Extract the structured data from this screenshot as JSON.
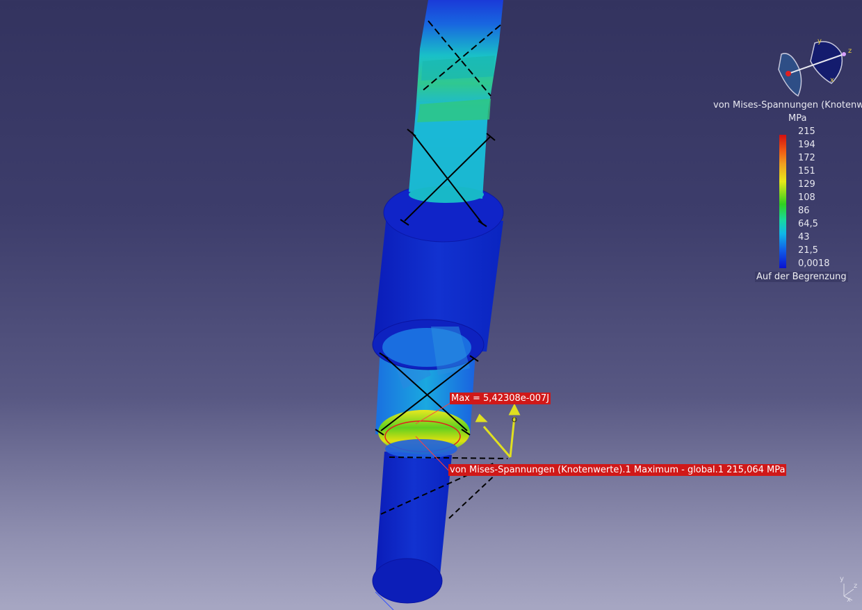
{
  "legend": {
    "title": "von Mises-Spannungen (Knotenwerte",
    "unit": "MPa",
    "values": [
      "215",
      "194",
      "172",
      "151",
      "129",
      "108",
      "86",
      "64,5",
      "43",
      "21,5",
      "0,0018"
    ],
    "footer": "Auf der Begrenzung"
  },
  "labels": {
    "max_energy": "Max = 5,42308e-007J",
    "max_stress": "von Mises-Spannungen (Knotenwerte).1  Maximum - global.1  215,064 MPa"
  },
  "compass": {
    "axis_x": "x",
    "axis_y": "y",
    "axis_z": "z"
  },
  "triad": {
    "axis_x": "x",
    "axis_y": "y",
    "axis_z": "z"
  },
  "colors": {
    "background_top": "#33335f",
    "background_bottom": "#a7a7c3",
    "low_stress": "#0a18c8",
    "max_stress": "#d21010",
    "label_fill": "#d01818",
    "annotation": "#e0e020"
  }
}
